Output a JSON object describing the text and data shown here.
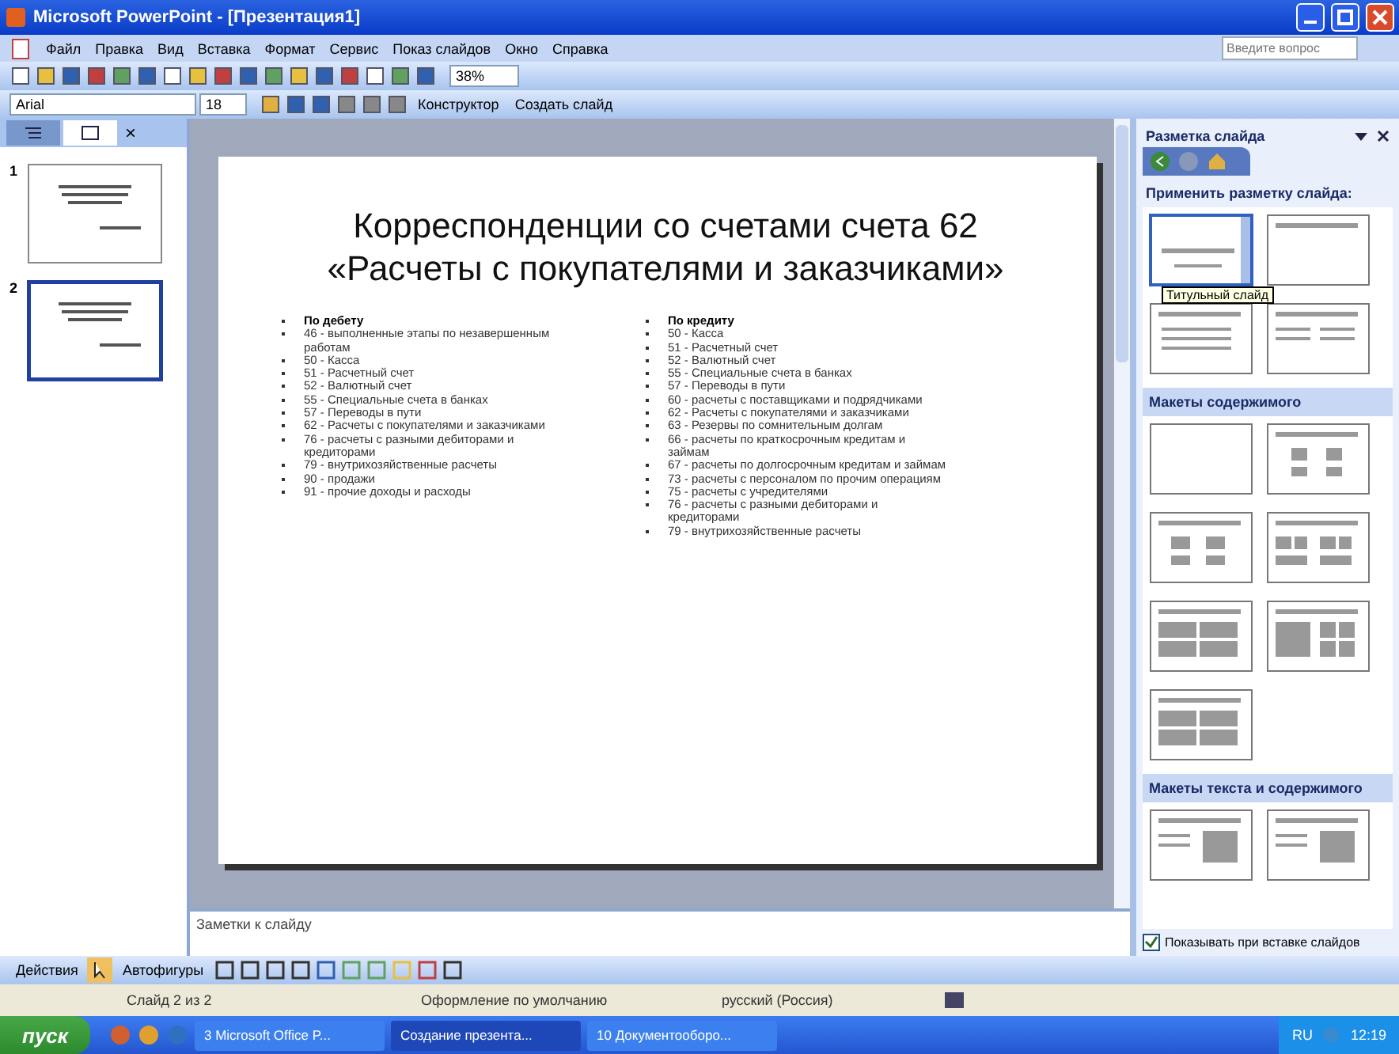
{
  "window": {
    "title": "Microsoft PowerPoint - [Презентация1]"
  },
  "menu": [
    "Файл",
    "Правка",
    "Вид",
    "Вставка",
    "Формат",
    "Сервис",
    "Показ слайдов",
    "Окно",
    "Справка"
  ],
  "help_search": {
    "placeholder": "Введите вопрос"
  },
  "standard_toolbar": {
    "zoom": "38%"
  },
  "formatting_toolbar": {
    "font": "Arial",
    "size": "18",
    "buttons": [
      "Конструктор",
      "Создать слайд"
    ]
  },
  "slides_pane": {
    "tabs": [
      {
        "kind": "outline",
        "selected": false
      },
      {
        "kind": "slides",
        "selected": true
      }
    ],
    "close": "×",
    "thumbnails": [
      {
        "number": "1",
        "selected": false
      },
      {
        "number": "2",
        "selected": true
      }
    ]
  },
  "slide": {
    "title": [
      "Корреспонденции со счетами счета 62",
      "«Расчеты с покупателями и заказчиками»"
    ],
    "columns": [
      {
        "heading": "По дебету",
        "items": [
          "46 - выполненные этапы по незавершенным работам",
          "50 - Касса",
          "51 - Расчетный счет",
          "52 - Валютный счет",
          "55 - Специальные счета в банках",
          "57 - Переводы в пути",
          "62 - Расчеты с покупателями и заказчиками",
          "76 - расчеты с разными дебиторами и кредиторами",
          "79 - внутрихозяйственные расчеты",
          "90 - продажи",
          "91 - прочие доходы и расходы"
        ]
      },
      {
        "heading": "По кредиту",
        "items": [
          "50 - Касса",
          "51 - Расчетный счет",
          "52 - Валютный счет",
          "55 - Специальные счета в банках",
          "57 - Переводы в пути",
          "60 - расчеты с поставщиками и подрядчиками",
          "62 - Расчеты с покупателями и заказчиками",
          "63 - Резервы по сомнительным долгам",
          "66 - расчеты по краткосрочным кредитам и займам",
          "67 - расчеты по долгосрочным кредитам и займам",
          "73 - расчеты с персоналом по прочим операциям",
          "75 - расчеты с учредителями",
          "76 - расчеты с разными дебиторами и кредиторами",
          "79 - внутрихозяйственные расчеты"
        ]
      }
    ]
  },
  "notes": {
    "placeholder": "Заметки к слайду"
  },
  "task_pane": {
    "title": "Разметка слайда",
    "apply_label": "Применить разметку слайда:",
    "tooltip": "Титульный слайд",
    "sections": [
      {
        "layouts": [
          {
            "kind": "title",
            "selected": true
          },
          {
            "kind": "title-only",
            "selected": false
          },
          {
            "kind": "bullets",
            "selected": false
          },
          {
            "kind": "two-bullets",
            "selected": false
          }
        ]
      },
      {
        "heading": "Макеты содержимого",
        "layouts": [
          {
            "kind": "blank",
            "selected": false
          },
          {
            "kind": "content",
            "selected": false
          },
          {
            "kind": "title-content",
            "selected": false
          },
          {
            "kind": "two-content",
            "selected": false
          },
          {
            "kind": "four-content",
            "selected": false
          },
          {
            "kind": "three-content",
            "selected": false
          },
          {
            "kind": "four-content",
            "selected": false
          }
        ]
      },
      {
        "heading": "Макеты текста и содержимого",
        "layouts": [
          {
            "kind": "text-content",
            "selected": false
          },
          {
            "kind": "text-content",
            "selected": false
          }
        ]
      }
    ],
    "show_on_insert": {
      "label": "Показывать при вставке слайдов",
      "checked": true
    }
  },
  "drawing_toolbar": {
    "actions": "Действия",
    "autoshapes": "Автофигуры"
  },
  "status_bar": [
    "Слайд 2 из 2",
    "Оформление по умолчанию",
    "русский (Россия)"
  ],
  "taskbar": {
    "start": "пуск",
    "tasks": [
      {
        "label": "3 Microsoft Office P...",
        "selected": false
      },
      {
        "label": "Создание презента...",
        "selected": true
      },
      {
        "label": "10 Документооборо...",
        "selected": false
      }
    ],
    "lang": "RU",
    "clock": "12:19"
  }
}
